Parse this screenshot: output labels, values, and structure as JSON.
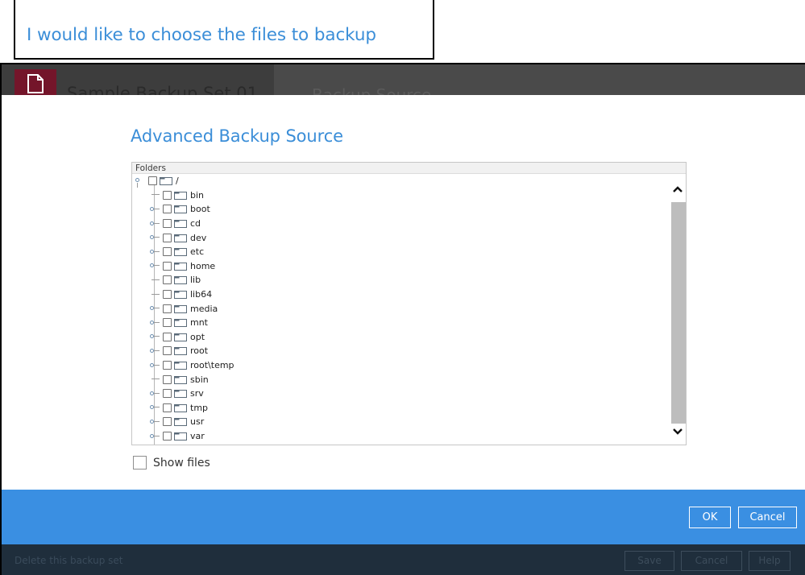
{
  "callout": {
    "text": "I would like to choose the files to backup"
  },
  "header": {
    "backup_set_name": "Sample Backup Set 01",
    "section_title": "Backup Source"
  },
  "dialog": {
    "title": "Advanced Backup Source",
    "tree_header": "Folders",
    "root_label": "/",
    "items": [
      {
        "label": "bin",
        "expandable": false
      },
      {
        "label": "boot",
        "expandable": true
      },
      {
        "label": "cd",
        "expandable": true
      },
      {
        "label": "dev",
        "expandable": true
      },
      {
        "label": "etc",
        "expandable": true
      },
      {
        "label": "home",
        "expandable": true
      },
      {
        "label": "lib",
        "expandable": false
      },
      {
        "label": "lib64",
        "expandable": false
      },
      {
        "label": "media",
        "expandable": true
      },
      {
        "label": "mnt",
        "expandable": true
      },
      {
        "label": "opt",
        "expandable": true
      },
      {
        "label": "root",
        "expandable": true
      },
      {
        "label": "root\\temp",
        "expandable": true
      },
      {
        "label": "sbin",
        "expandable": false
      },
      {
        "label": "srv",
        "expandable": true
      },
      {
        "label": "tmp",
        "expandable": true
      },
      {
        "label": "usr",
        "expandable": true
      },
      {
        "label": "var",
        "expandable": true
      }
    ],
    "show_files_label": "Show files",
    "ok_label": "OK",
    "cancel_label": "Cancel"
  },
  "footer": {
    "delete_label": "Delete this backup set",
    "save_label": "Save",
    "cancel_label": "Cancel",
    "help_label": "Help"
  },
  "colors": {
    "accent": "#3a8fe2",
    "title_blue": "#3b8ed8",
    "footer_bg": "#1f2e3c",
    "doc_badge": "#74152a"
  }
}
